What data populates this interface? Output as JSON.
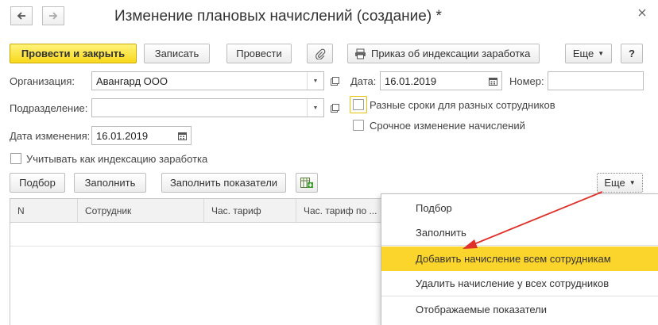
{
  "window": {
    "title": "Изменение плановых начислений (создание) *"
  },
  "toolbar": {
    "post_close": "Провести и закрыть",
    "save": "Записать",
    "post": "Провести",
    "order": "Приказ об индексации заработка",
    "more": "Еще",
    "help": "?"
  },
  "form": {
    "org_label": "Организация:",
    "org_value": "Авангард ООО",
    "date_label": "Дата:",
    "date_value": "16.01.2019",
    "number_label": "Номер:",
    "number_value": "",
    "dept_label": "Подразделение:",
    "dept_value": "",
    "change_date_label": "Дата изменения:",
    "change_date_value": "16.01.2019",
    "diff_dates_label": "Разные сроки для разных сотрудников",
    "urgent_label": "Срочное изменение начислений",
    "indexation_label": "Учитывать как индексацию заработка"
  },
  "table_toolbar": {
    "pick": "Подбор",
    "fill": "Заполнить",
    "fill_indicators": "Заполнить показатели",
    "more": "Еще"
  },
  "table": {
    "columns": [
      "N",
      "Сотрудник",
      "Час. тариф",
      "Час. тариф по ..."
    ]
  },
  "menu": {
    "items": [
      "Подбор",
      "Заполнить",
      "Добавить начисление всем сотрудникам",
      "Удалить начисление у всех сотрудников",
      "Отображаемые показатели"
    ]
  },
  "colors": {
    "primary_button": "#f8d81c",
    "menu_highlight": "#fbd42c",
    "arrow": "#e0302a"
  }
}
